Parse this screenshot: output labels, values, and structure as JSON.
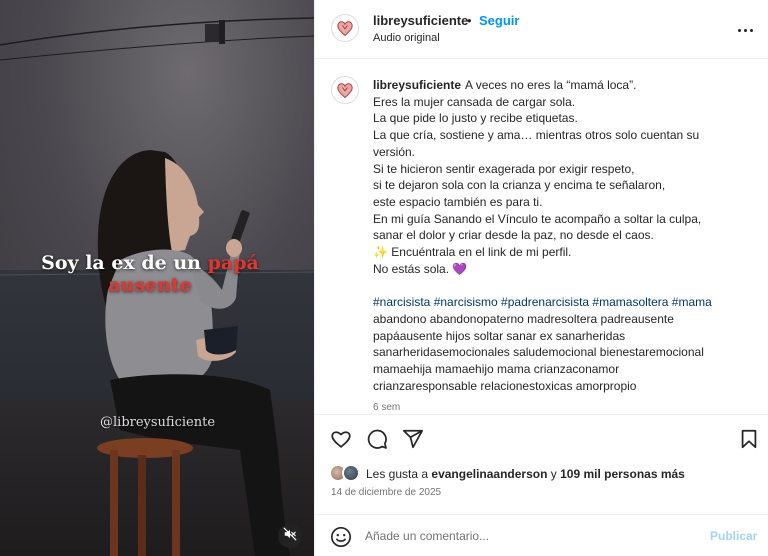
{
  "colors": {
    "accent": "#0095f6",
    "title_accent": "#e4352e",
    "hashtag": "#00376b",
    "publish_disabled": "#a3d3fb"
  },
  "media": {
    "overlay_line1_part1": "Soy la ex de un",
    "overlay_line1_accent": "papá",
    "overlay_line2_accent": "ausente",
    "watermark": "@libreysuficiente",
    "mute_icon": "speaker-muted-icon"
  },
  "header": {
    "username": "libreysuficiente",
    "separator": "•",
    "follow_label": "Seguir",
    "audio": "Audio original",
    "more_icon": "more-horizontal-icon"
  },
  "caption": {
    "username": "libreysuficiente",
    "lines": [
      "A veces no eres la “mamá loca”.",
      "Eres la mujer cansada de cargar sola.",
      "La que pide lo justo y recibe etiquetas.",
      "La que cría, sostiene y ama… mientras otros solo cuentan su",
      "versión.",
      "Si te hicieron sentir exagerada por exigir respeto,",
      "si te dejaron sola con la crianza y encima te señalaron,",
      "este espacio también es para ti.",
      "En mi guía Sanando el Vínculo te acompaño a soltar la culpa,",
      "sanar el dolor y criar desde la paz, no desde el caos.",
      "✨ Encuéntrala en el link de mi perfil.",
      "No estás sola. 💜"
    ],
    "hashtag_line": "#narcisista #narcisismo #padrenarcisista #mamasoltera #mama",
    "keyword_lines": [
      "abandono abandonopaterno madresoltera padreausente",
      "papáausente hijos soltar sanar ex sanarheridas",
      "sanarheridasemocionales saludemocional bienestaremocional",
      "mamaehija mamaehijo mama crianzaconamor",
      "crianzaresponsable relacionestoxicas amorpropio"
    ],
    "time_ago": "6 sem"
  },
  "actions": {
    "like_icon": "heart-outline-icon",
    "comment_icon": "comment-bubble-icon",
    "share_icon": "send-paper-plane-icon",
    "save_icon": "bookmark-icon"
  },
  "likes": {
    "prefix": "Les gusta a ",
    "user": "evangelinaanderson",
    "middle": " y ",
    "others": "109 mil personas más",
    "date": "14 de diciembre de 2025"
  },
  "comment_box": {
    "placeholder": "Añade un comentario...",
    "publish_label": "Publicar",
    "emoji_icon": "emoji-smiley-icon"
  }
}
